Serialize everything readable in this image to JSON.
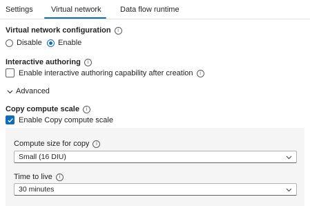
{
  "tabs": [
    {
      "label": "Settings"
    },
    {
      "label": "Virtual network"
    },
    {
      "label": "Data flow runtime"
    }
  ],
  "vnet": {
    "title": "Virtual network configuration",
    "options": [
      {
        "label": "Disable",
        "selected": false
      },
      {
        "label": "Enable",
        "selected": true
      }
    ]
  },
  "interactive": {
    "title": "Interactive authoring",
    "checkbox_label": "Enable interactive authoring capability after creation",
    "checked": false
  },
  "advanced": {
    "label": "Advanced",
    "expanded": true
  },
  "copy_scale": {
    "title": "Copy compute scale",
    "checkbox_label": "Enable Copy compute scale",
    "checked": true,
    "compute_size": {
      "label": "Compute size for copy",
      "value": "Small (16 DIU)"
    },
    "ttl": {
      "label": "Time to live",
      "value": "30 minutes"
    }
  },
  "colors": {
    "accent": "#0f6cbd",
    "panel_bg": "#f5f5f5"
  }
}
